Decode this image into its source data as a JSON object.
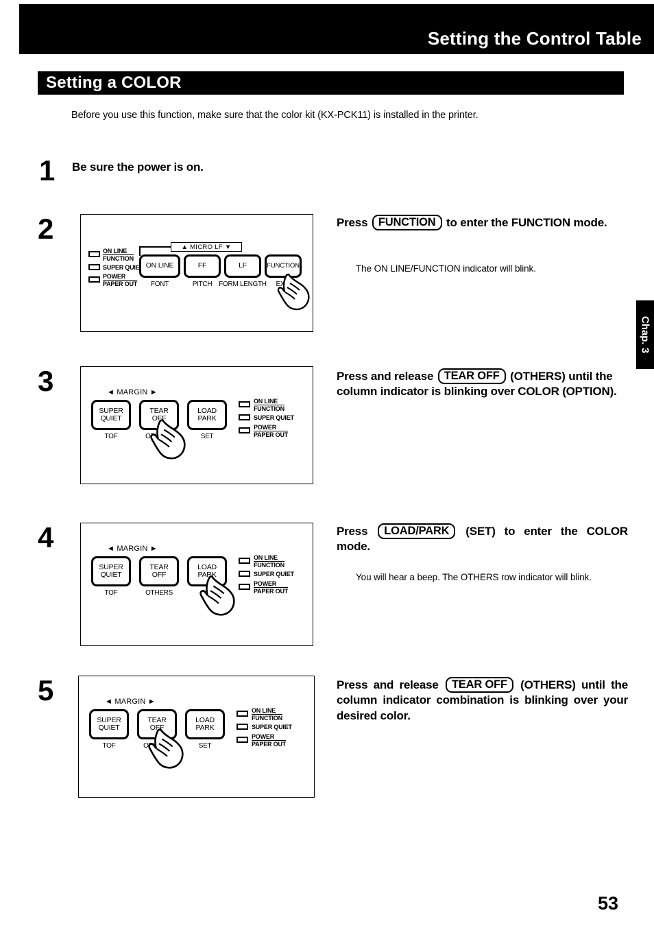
{
  "header": {
    "title": "Setting the Control Table"
  },
  "section": {
    "title": "Setting a COLOR"
  },
  "intro": "Before you use this function, make sure that the color kit (KX-PCK11) is installed in the printer.",
  "chapter_tab": "Chap. 3",
  "page_number": "53",
  "steps": [
    {
      "number": "1",
      "heading": "Be sure the power is on."
    },
    {
      "number": "2",
      "instruction_pre": "Press",
      "keycap": "FUNCTION",
      "instruction_post": "to enter the FUNCTION mode.",
      "note": "The ON LINE/FUNCTION indicator will blink."
    },
    {
      "number": "3",
      "instruction_pre": "Press and release",
      "keycap": "TEAR OFF",
      "instruction_post": "(OTHERS) until the column indicator is blinking over COLOR (OPTION).",
      "note": ""
    },
    {
      "number": "4",
      "instruction_pre": "Press",
      "keycap": "LOAD/PARK",
      "instruction_post": "(SET) to enter the COLOR mode.",
      "note": "You will hear a beep. The OTHERS row indicator will blink."
    },
    {
      "number": "5",
      "instruction_pre": "Press and release",
      "keycap": "TEAR OFF",
      "instruction_post": "(OTHERS) until the column indicator combination is blinking over your desired color.",
      "note": ""
    }
  ],
  "panel_function": {
    "micro_lf": "▲  MICRO LF   ▼",
    "buttons": [
      {
        "label": "ON LINE",
        "sublabel": "FONT"
      },
      {
        "label": "FF",
        "sublabel": "PITCH"
      },
      {
        "label": "LF",
        "sublabel": "FORM LENGTH"
      },
      {
        "label": "FUNCTION",
        "sublabel": "EXIT"
      }
    ],
    "indicators": [
      {
        "line1": "ON LINE",
        "line2": "FUNCTION"
      },
      {
        "line1": "SUPER QUIET",
        "line2": ""
      },
      {
        "line1": "POWER",
        "line2": "PAPER OUT"
      }
    ]
  },
  "panel_margin": {
    "margin_label": "◄ MARGIN ►",
    "buttons": [
      {
        "line1": "SUPER",
        "line2": "QUIET",
        "sublabel": "TOF"
      },
      {
        "line1": "TEAR",
        "line2": "OFF",
        "sublabel": "OTHERS"
      },
      {
        "line1": "LOAD",
        "line2": "PARK",
        "sublabel": "SET"
      }
    ],
    "indicators": [
      {
        "line1": "ON LINE",
        "line2": "FUNCTION"
      },
      {
        "line1": "SUPER QUIET",
        "line2": ""
      },
      {
        "line1": "POWER",
        "line2": "PAPER OUT"
      }
    ]
  },
  "icons": {
    "hand_pointer": "hand-pointer-icon"
  }
}
